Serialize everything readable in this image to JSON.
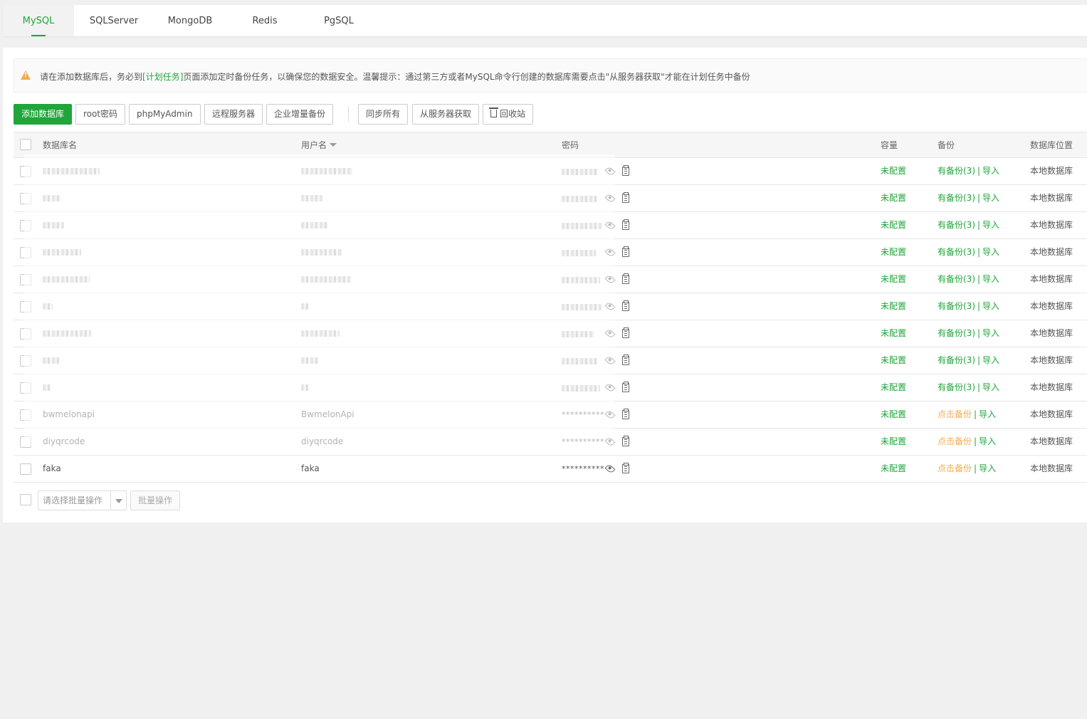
{
  "tabs": [
    {
      "label": "MySQL",
      "active": true
    },
    {
      "label": "SQLServer"
    },
    {
      "label": "MongoDB"
    },
    {
      "label": "Redis"
    },
    {
      "label": "PgSQL"
    }
  ],
  "notice": {
    "before": "请在添加数据库后，务必到",
    "link": "[计划任务]",
    "after": "页面添加定时备份任务，以确保您的数据安全。温馨提示：通过第三方或者MySQL命令行创建的数据库需要点击\"从服务器获取\"才能在计划任务中备份"
  },
  "toolbar": {
    "add_db": "添加数据库",
    "root_pwd": "root密码",
    "phpmyadmin": "phpMyAdmin",
    "remote_server": "远程服务器",
    "enterprise_backup": "企业增量备份",
    "sync_all": "同步所有",
    "get_from_server": "从服务器获取",
    "recycle_bin": "回收站"
  },
  "table": {
    "headers": {
      "name": "数据库名",
      "user": "用户名",
      "password": "密码",
      "capacity": "容量",
      "backup": "备份",
      "location": "数据库位置"
    },
    "redacted_rows": [
      {
        "capacity": "未配置",
        "backup": "有备份(3)",
        "import": "导入",
        "location": "本地数据库"
      },
      {
        "capacity": "未配置",
        "backup": "有备份(3)",
        "import": "导入",
        "location": "本地数据库"
      },
      {
        "capacity": "未配置",
        "backup": "有备份(3)",
        "import": "导入",
        "location": "本地数据库"
      },
      {
        "capacity": "未配置",
        "backup": "有备份(3)",
        "import": "导入",
        "location": "本地数据库"
      },
      {
        "capacity": "未配置",
        "backup": "有备份(3)",
        "import": "导入",
        "location": "本地数据库"
      },
      {
        "capacity": "未配置",
        "backup": "有备份(3)",
        "import": "导入",
        "location": "本地数据库"
      },
      {
        "capacity": "未配置",
        "backup": "有备份(3)",
        "import": "导入",
        "location": "本地数据库"
      },
      {
        "capacity": "未配置",
        "backup": "有备份(3)",
        "import": "导入",
        "location": "本地数据库"
      },
      {
        "capacity": "未配置",
        "backup": "有备份(3)",
        "import": "导入",
        "location": "本地数据库"
      }
    ],
    "rows": [
      {
        "name": "bwmelonapi",
        "user": "BwmelonApi",
        "password": "**********",
        "capacity": "未配置",
        "backup": "点击备份",
        "import": "导入",
        "location": "本地数据库"
      },
      {
        "name": "diyqrcode",
        "user": "diyqrcode",
        "password": "**********",
        "capacity": "未配置",
        "backup": "点击备份",
        "import": "导入",
        "location": "本地数据库"
      },
      {
        "name": "faka",
        "user": "faka",
        "password": "**********",
        "capacity": "未配置",
        "backup": "点击备份",
        "import": "导入",
        "location": "本地数据库"
      }
    ]
  },
  "batch": {
    "select_placeholder": "请选择批量操作",
    "button": "批量操作"
  },
  "colors": {
    "accent": "#20a53a",
    "warning": "#f0ad4e"
  },
  "icons": {
    "warning": "warning-triangle-icon",
    "eye": "eye-icon",
    "copy": "copy-icon",
    "trash": "trash-icon",
    "sort": "sort-down-icon",
    "dropdown": "chevron-down-icon"
  }
}
